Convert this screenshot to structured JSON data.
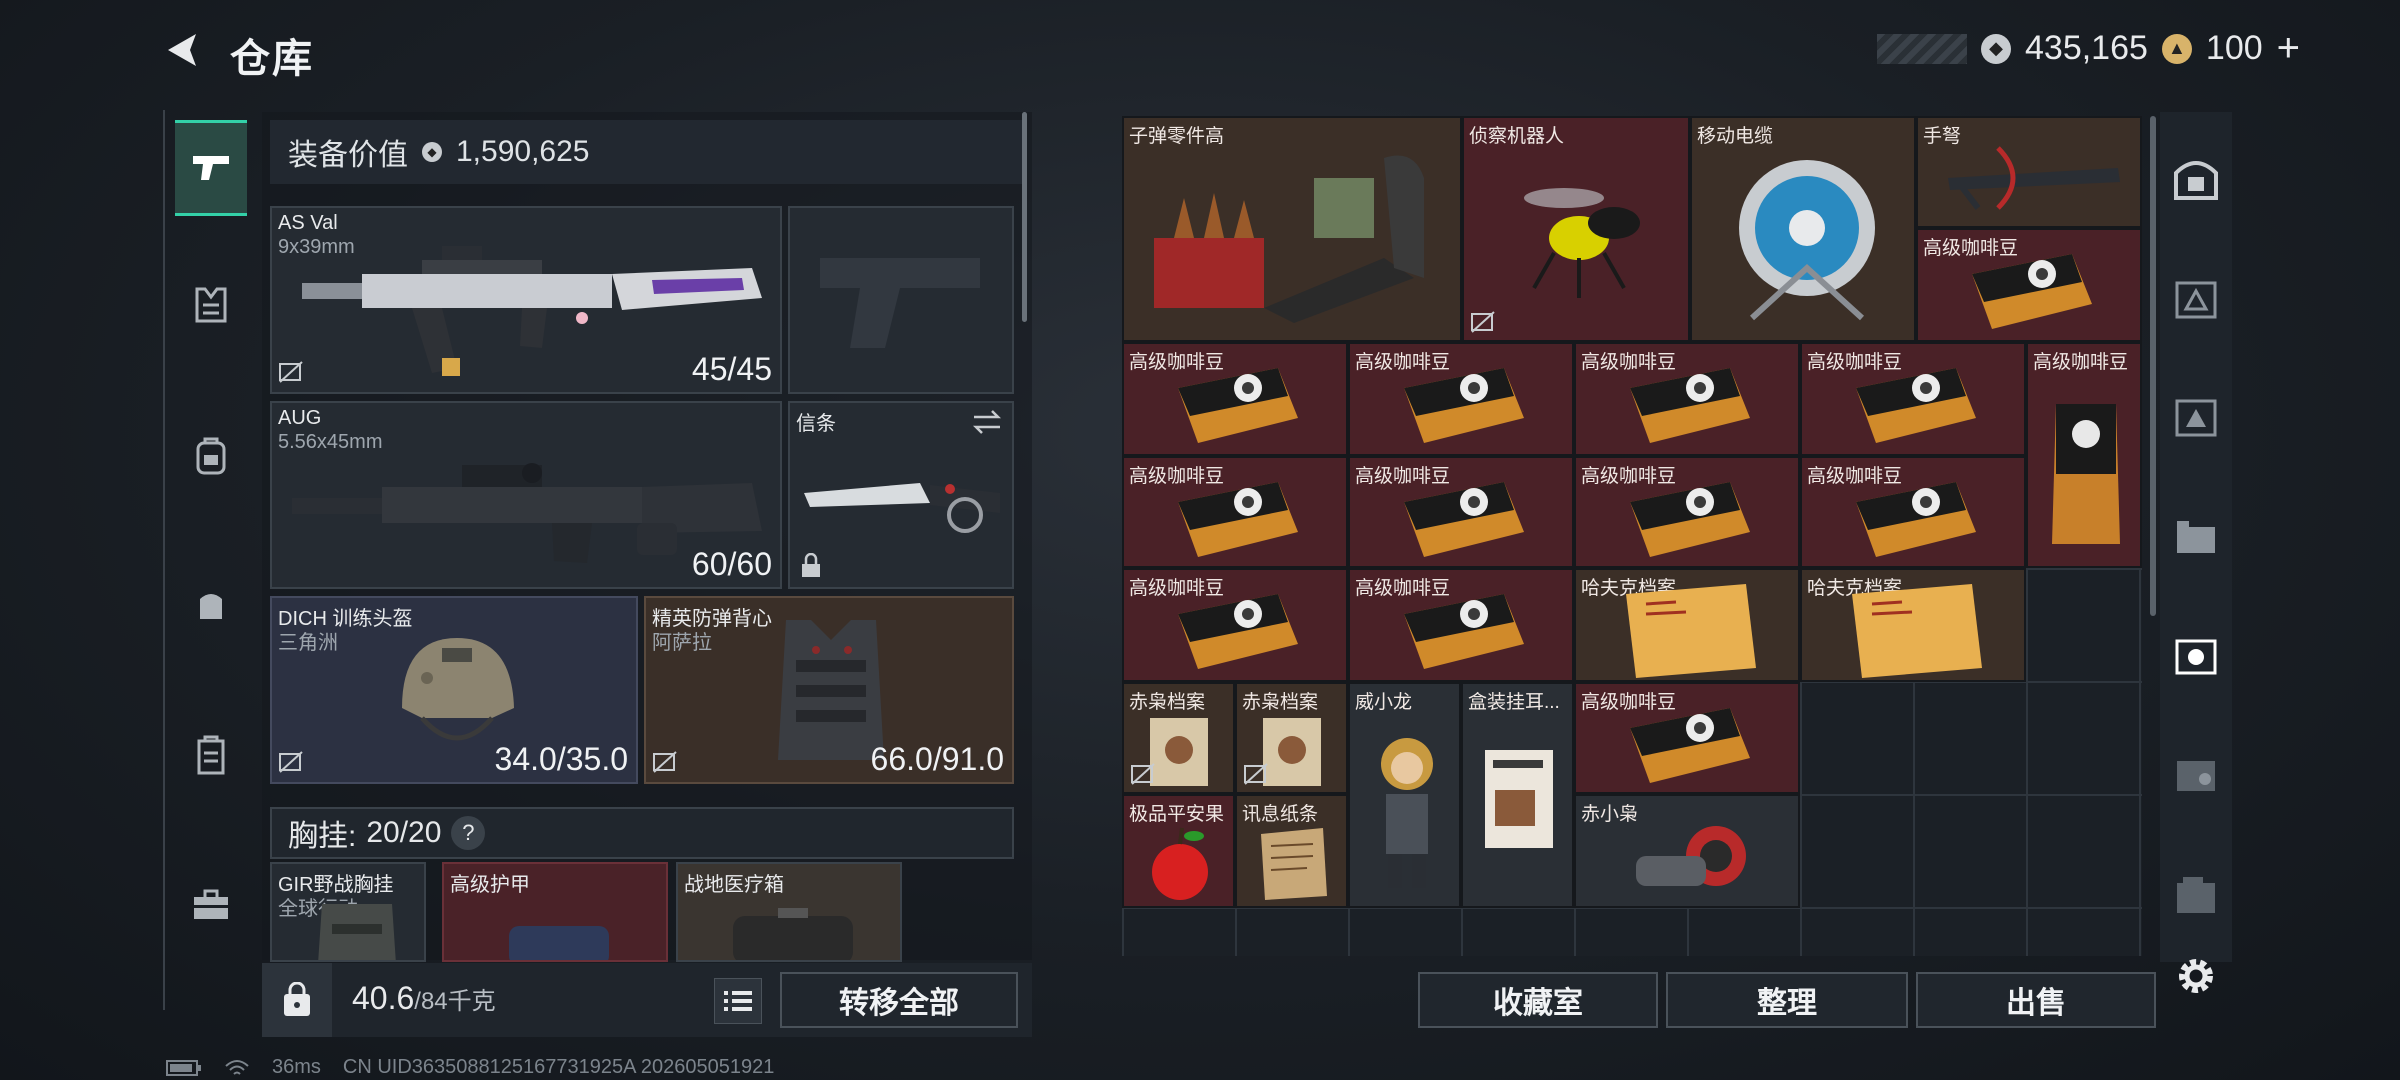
{
  "header": {
    "title": "仓库",
    "currency_silver": "435,165",
    "currency_gold": "100",
    "currency_add": "+"
  },
  "loadout": {
    "equip_value_label": "装备价值",
    "equip_value": "1,590,625",
    "primary": {
      "name": "AS Val",
      "caliber": "9x39mm",
      "ammo": "45/45"
    },
    "secondary": {
      "name": "AUG",
      "caliber": "5.56x45mm",
      "ammo": "60/60"
    },
    "melee": {
      "name": "信条"
    },
    "helmet": {
      "name": "DICH 训练头盔",
      "origin": "三角洲",
      "durability": "34.0/35.0"
    },
    "armor": {
      "name": "精英防弹背心",
      "origin": "阿萨拉",
      "durability": "66.0/91.0"
    },
    "chest_rig": {
      "label": "胸挂:",
      "value": "20/20",
      "help": "?"
    },
    "rig_items": [
      {
        "name": "GIR野战胸挂",
        "sub": "全球行动"
      },
      {
        "name": "高级护甲"
      },
      {
        "name": "战地医疗箱"
      }
    ],
    "weight": "40.6",
    "weight_max": "/84千克",
    "transfer_all": "转移全部"
  },
  "storage": {
    "items": [
      {
        "label": "子弹零件高"
      },
      {
        "label": "侦察机器人"
      },
      {
        "label": "移动电缆"
      },
      {
        "label": "手弩"
      },
      {
        "label": "高级咖啡豆"
      },
      {
        "label": "高级咖啡豆"
      },
      {
        "label": "高级咖啡豆"
      },
      {
        "label": "高级咖啡豆"
      },
      {
        "label": "高级咖啡豆"
      },
      {
        "label": "高级咖啡豆"
      },
      {
        "label": "高级咖啡豆"
      },
      {
        "label": "高级咖啡豆"
      },
      {
        "label": "高级咖啡豆"
      },
      {
        "label": "高级咖啡豆"
      },
      {
        "label": "高级咖啡豆"
      },
      {
        "label": "高级咖啡豆"
      },
      {
        "label": "哈夫克档案"
      },
      {
        "label": "哈夫克档案"
      },
      {
        "label": "赤枭档案"
      },
      {
        "label": "赤枭档案"
      },
      {
        "label": "威小龙"
      },
      {
        "label": "盒装挂耳..."
      },
      {
        "label": "高级咖啡豆"
      },
      {
        "label": "极品平安果"
      },
      {
        "label": "讯息纸条"
      },
      {
        "label": "赤小枭"
      }
    ],
    "collection_room": "收藏室",
    "organize": "整理",
    "sell": "出售"
  },
  "status_bar": {
    "ping": "36ms",
    "uid": "CN UID3635088125167731925A 202605051921"
  },
  "colors": {
    "accent": "#33d1a8",
    "item_red": "#4a2127",
    "item_brown": "#3b2f27"
  }
}
